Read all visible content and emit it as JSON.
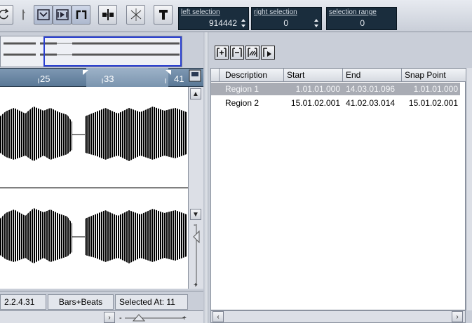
{
  "selection": {
    "left_label": "left selection",
    "left_value": "914442",
    "right_label": "right selection",
    "right_value": "0",
    "range_label": "selection range",
    "range_value": "0"
  },
  "ruler": {
    "marks": [
      "25",
      "33",
      "41"
    ]
  },
  "status": {
    "position": "2.2.4.31",
    "format": "Bars+Beats",
    "selected_at": "Selected At:  11"
  },
  "regions": {
    "columns": [
      "Description",
      "Start",
      "End",
      "Snap Point"
    ],
    "rows": [
      {
        "description": "Region 1",
        "start": "1.01.01.000",
        "end": "14.03.01.096",
        "snap": "1.01.01.000",
        "selected": true
      },
      {
        "description": "Region 2",
        "start": "15.01.02.001",
        "end": "41.02.03.014",
        "snap": "15.01.02.001",
        "selected": false
      }
    ]
  },
  "colors": {
    "selection_box_bg": "#1a2d3d",
    "ruler_bg": "#5a7896",
    "overview_selection": "#2a3fd0",
    "selected_row_bg": "#a9acb4"
  },
  "icons": [
    "loop-icon",
    "scrub-icon",
    "waveform-zoom-icon",
    "play-region-icon",
    "region-bracket-icon",
    "snap-to-icon",
    "cut-icon",
    "marker-icon",
    "add-region-icon",
    "remove-region-icon",
    "select-regions-icon",
    "play-region-list-icon"
  ]
}
